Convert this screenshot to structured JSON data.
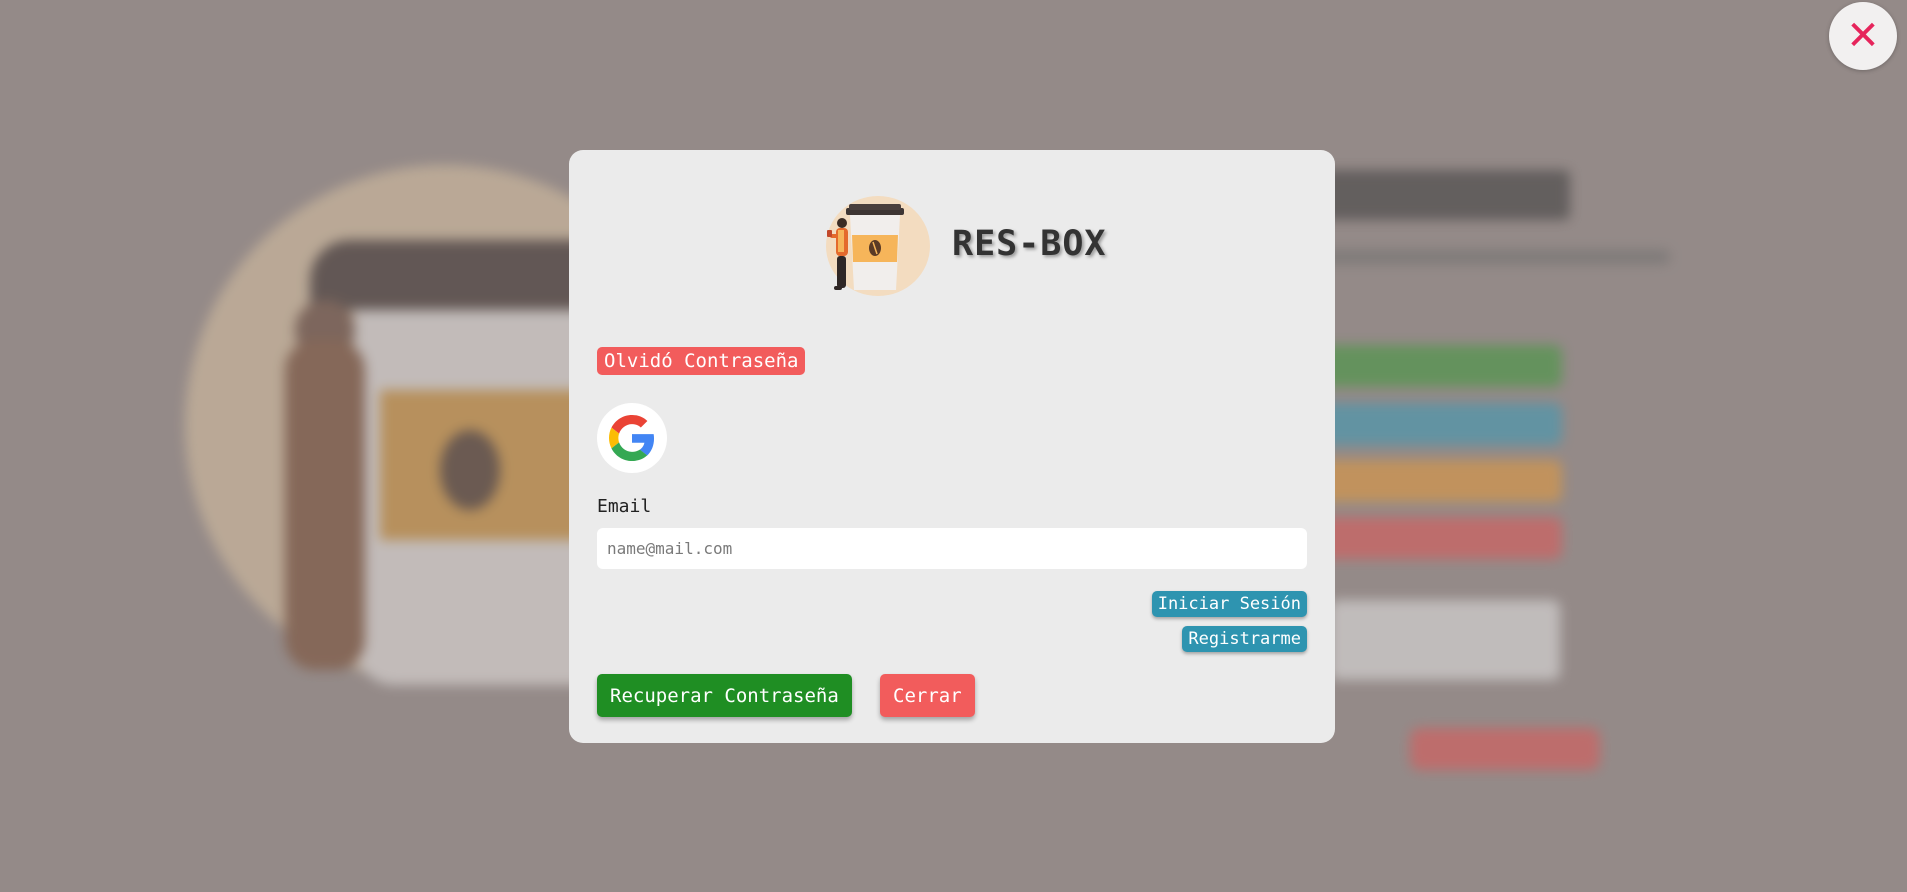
{
  "app": {
    "name": "RES-BOX"
  },
  "modal": {
    "badge": "Olvidó Contraseña",
    "email_label": "Email",
    "email_value": "",
    "email_placeholder": "name@mail.com",
    "login_link": "Iniciar Sesión",
    "register_link": "Registrarme",
    "recover_button": "Recuperar Contraseña",
    "close_button": "Cerrar"
  },
  "overlay": {
    "close_symbol": "✕"
  },
  "icons": {
    "logo": "coffee-cup-person-logo",
    "google": "google-icon",
    "close": "close-icon"
  },
  "colors": {
    "overlay": "#948a88",
    "modal_bg": "#ebebeb",
    "danger": "#f25c5c",
    "success": "#1f8e23",
    "info": "#2e94b0",
    "close_x": "#e6245b"
  }
}
